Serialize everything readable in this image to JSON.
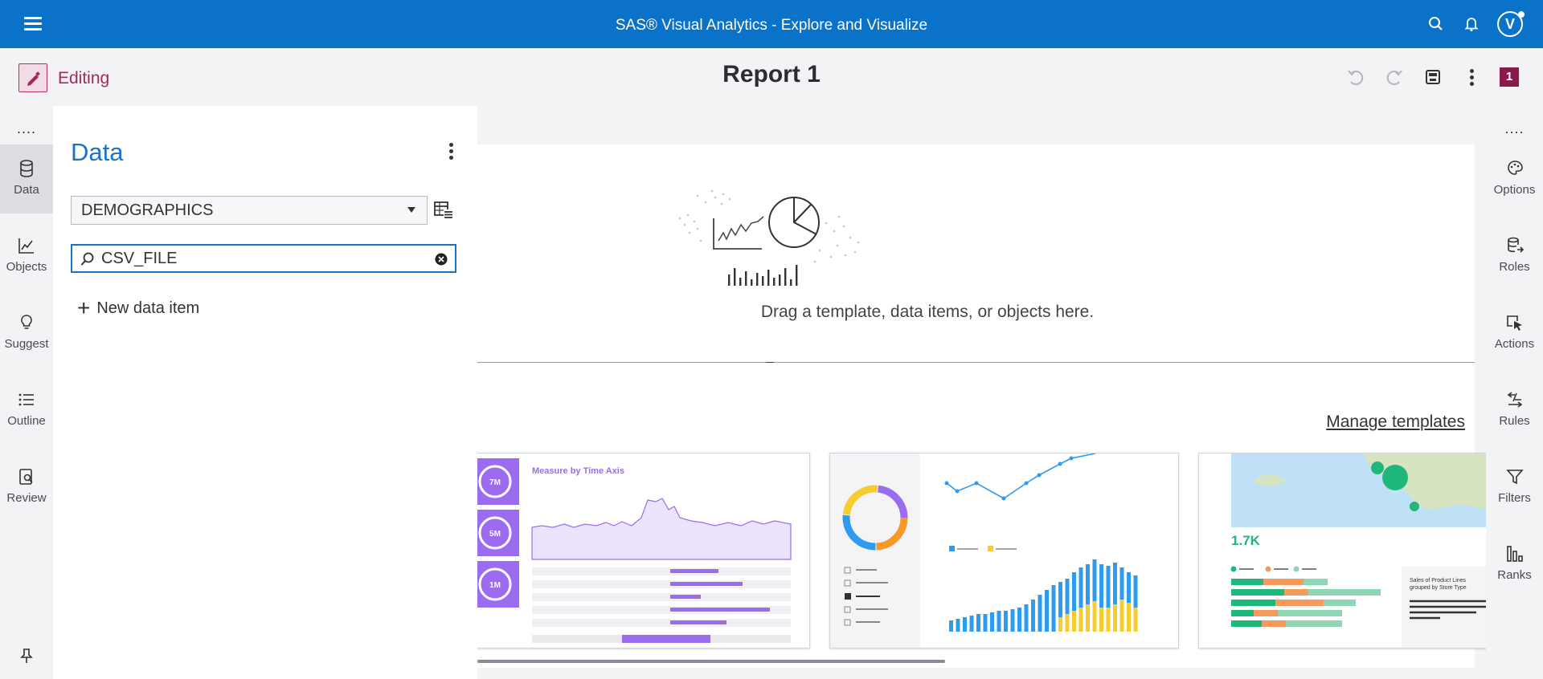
{
  "app": {
    "title": "SAS® Visual Analytics - Explore and Visualize",
    "user_initial": "V"
  },
  "editbar": {
    "mode_label": "Editing",
    "report_title": "Report 1",
    "page_number": "1"
  },
  "left_rail": {
    "more": "....",
    "items": [
      {
        "label": "Data",
        "icon": "database-icon",
        "active": true
      },
      {
        "label": "Objects",
        "icon": "line-chart-icon"
      },
      {
        "label": "Suggest",
        "icon": "lightbulb-icon"
      },
      {
        "label": "Outline",
        "icon": "list-icon"
      },
      {
        "label": "Review",
        "icon": "review-icon"
      }
    ]
  },
  "data_pane": {
    "title": "Data",
    "data_source": "DEMOGRAPHICS",
    "search_value": "CSV_FILE",
    "new_item_label": "New data item"
  },
  "canvas": {
    "drop_text": "Drag a template, data items, or objects here.",
    "manage_templates": "Manage templates",
    "template1": {
      "heading": "Measure by Time Axis",
      "kpis": [
        "7M",
        "5M",
        "1M"
      ]
    },
    "template3": {
      "kpi": "1.7K",
      "caption_line1": "Sales of Product Lines",
      "caption_line2": "grouped by Store Type"
    }
  },
  "right_rail": {
    "more": "....",
    "items": [
      {
        "label": "Options",
        "icon": "paint-icon"
      },
      {
        "label": "Roles",
        "icon": "roles-icon"
      },
      {
        "label": "Actions",
        "icon": "cursor-icon"
      },
      {
        "label": "Rules",
        "icon": "rules-icon"
      },
      {
        "label": "Filters",
        "icon": "filter-icon"
      },
      {
        "label": "Ranks",
        "icon": "ranks-icon"
      }
    ]
  },
  "colors": {
    "brand_blue": "#0a72c8",
    "edit_accent": "#a02a5e",
    "template_purple": "#9b6cf0",
    "chart_blue": "#2d9cf0",
    "chart_yellow": "#f7cc2e",
    "map_green": "#1fb87a"
  }
}
